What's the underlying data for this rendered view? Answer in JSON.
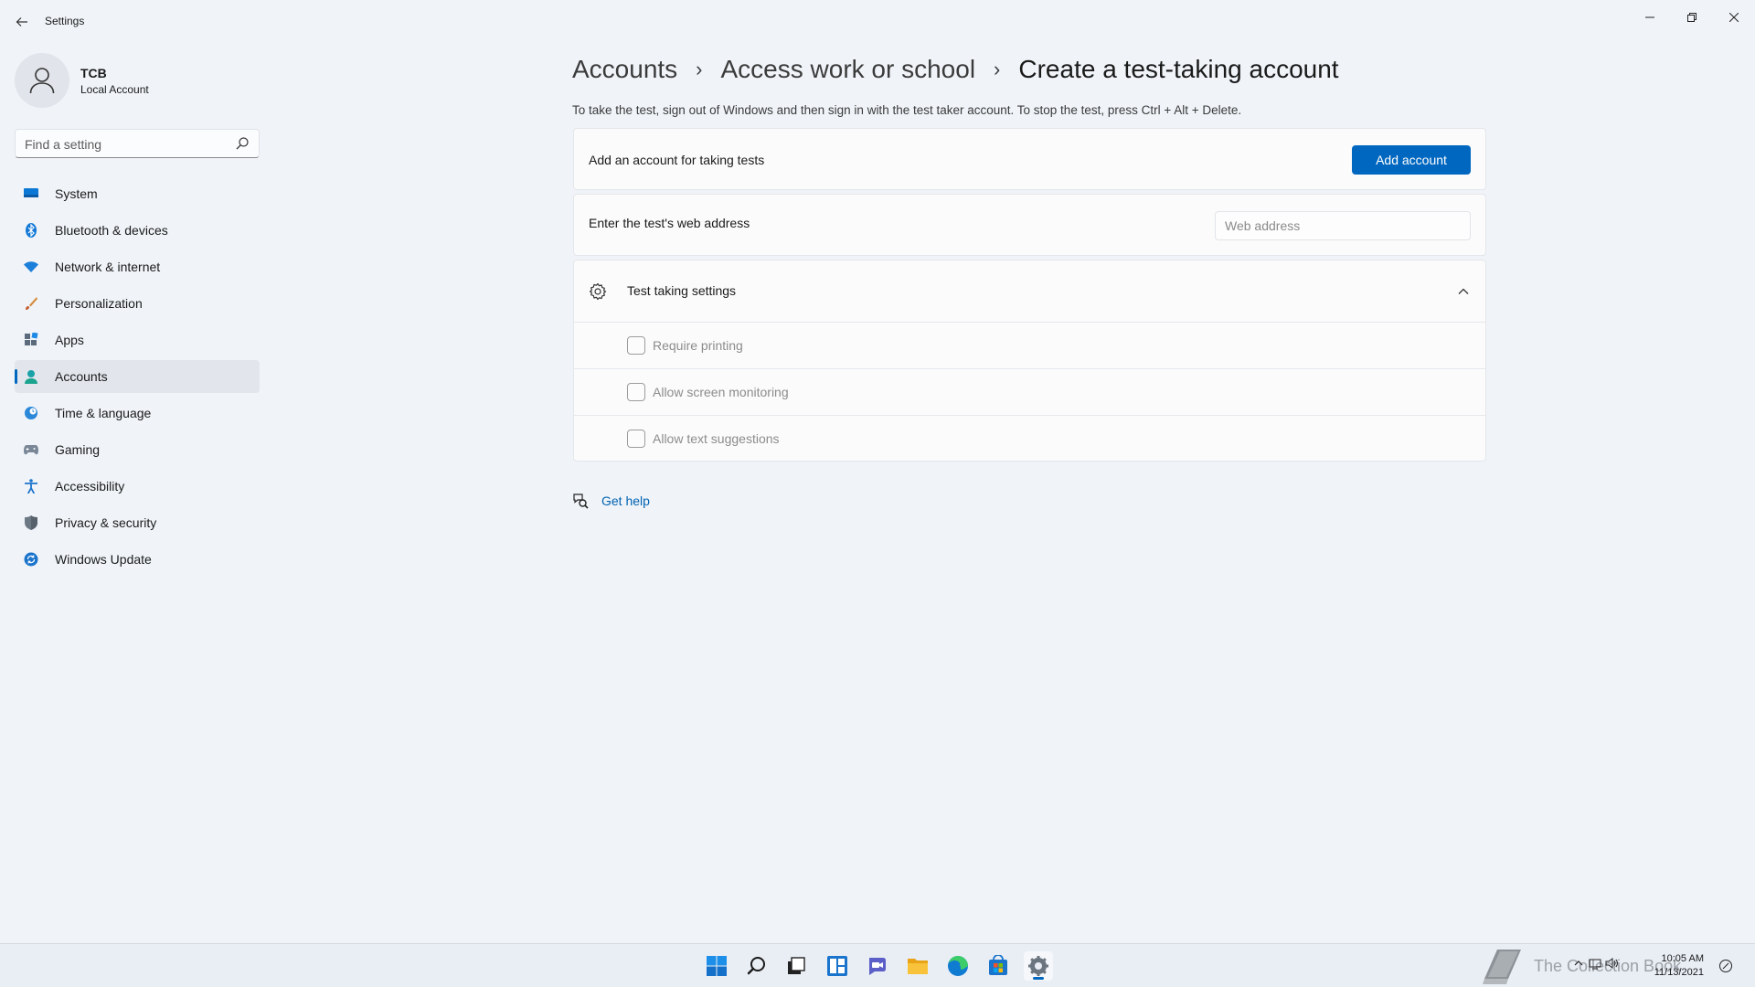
{
  "window": {
    "title": "Settings",
    "back_icon": "back-arrow-icon",
    "controls": [
      "minimize-icon",
      "restore-icon",
      "close-icon"
    ]
  },
  "profile": {
    "name": "TCB",
    "account_type": "Local Account",
    "icon": "user-avatar-icon"
  },
  "search": {
    "placeholder": "Find a setting",
    "icon": "search-icon"
  },
  "sidebar": {
    "items": [
      {
        "label": "System",
        "icon": "system-icon",
        "active": false
      },
      {
        "label": "Bluetooth & devices",
        "icon": "bluetooth-icon",
        "active": false
      },
      {
        "label": "Network & internet",
        "icon": "wifi-icon",
        "active": false
      },
      {
        "label": "Personalization",
        "icon": "brush-icon",
        "active": false
      },
      {
        "label": "Apps",
        "icon": "apps-icon",
        "active": false
      },
      {
        "label": "Accounts",
        "icon": "accounts-icon",
        "active": true
      },
      {
        "label": "Time & language",
        "icon": "globe-clock-icon",
        "active": false
      },
      {
        "label": "Gaming",
        "icon": "gamepad-icon",
        "active": false
      },
      {
        "label": "Accessibility",
        "icon": "accessibility-icon",
        "active": false
      },
      {
        "label": "Privacy & security",
        "icon": "shield-icon",
        "active": false
      },
      {
        "label": "Windows Update",
        "icon": "update-icon",
        "active": false
      }
    ]
  },
  "breadcrumb": {
    "items": [
      "Accounts",
      "Access work or school"
    ],
    "current": "Create a test-taking account",
    "separator": "›"
  },
  "main": {
    "description": "To take the test, sign out of Windows and then sign in with the test taker account. To stop the test, press Ctrl + Alt + Delete.",
    "add_account": {
      "label": "Add an account for taking tests",
      "button": "Add account"
    },
    "web_address": {
      "label": "Enter the test's web address",
      "placeholder": "Web address",
      "value": ""
    },
    "test_settings": {
      "title": "Test taking settings",
      "expanded": true,
      "options": [
        {
          "label": "Require printing",
          "checked": false,
          "enabled": false
        },
        {
          "label": "Allow screen monitoring",
          "checked": false,
          "enabled": false
        },
        {
          "label": "Allow text suggestions",
          "checked": false,
          "enabled": false
        }
      ]
    },
    "help": {
      "label": "Get help",
      "icon": "help-chat-icon"
    }
  },
  "taskbar": {
    "icons": [
      "windows-start-icon",
      "search-icon",
      "task-view-icon",
      "widgets-icon",
      "chat-icon",
      "file-explorer-icon",
      "edge-icon",
      "store-icon",
      "settings-icon"
    ],
    "active": "settings-icon",
    "watermark": "The Collection Book",
    "clock": {
      "time": "10:05 AM",
      "date": "11/13/2021"
    }
  },
  "colors": {
    "accent": "#0067c0",
    "background": "#f0f4f9",
    "link": "#0062b1"
  }
}
